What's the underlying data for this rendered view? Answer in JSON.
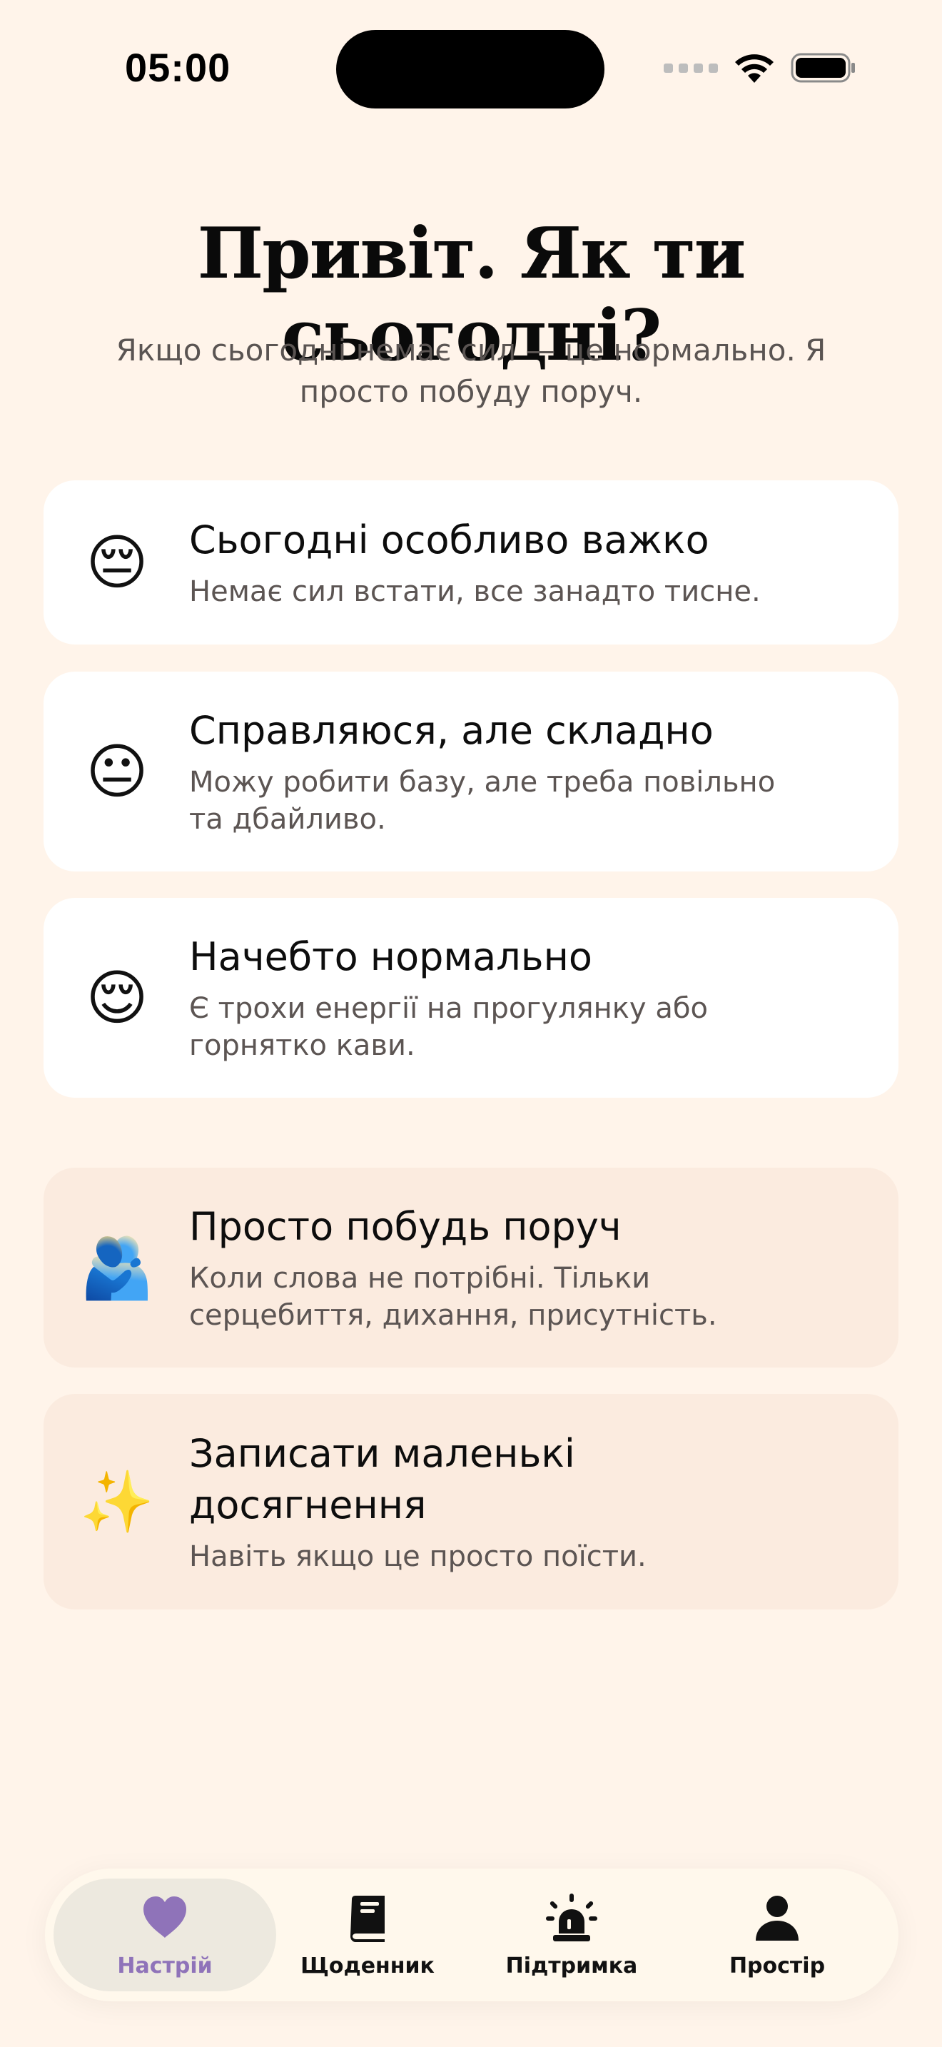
{
  "status_bar": {
    "time": "05:00"
  },
  "header": {
    "title": "Привіт. Як ти сьогодні?",
    "subtitle": "Якщо сьогодні немає сил — це нормально. Я просто побуду поруч."
  },
  "mood_options": [
    {
      "emoji": "😔",
      "title": "Сьогодні особливо важко",
      "description": "Немає сил встати, все занадто тисне."
    },
    {
      "emoji": "😐",
      "title": "Справляюся, але складно",
      "description": "Можу робити базу, але треба повільно та дбайливо."
    },
    {
      "emoji": "😌",
      "title": "Начебто нормально",
      "description": "Є трохи енергії на прогулянку або горнятко кави."
    }
  ],
  "actions": [
    {
      "emoji": "🫂",
      "title": "Просто побудь поруч",
      "description": "Коли слова не потрібні. Тільки серцебиття, дихання, присутність."
    },
    {
      "emoji": "✨",
      "title": "Записати маленькі досягнення",
      "description": "Навіть якщо це просто поїсти."
    }
  ],
  "tabs": [
    {
      "label": "Настрій",
      "icon": "heart-icon",
      "active": true
    },
    {
      "label": "Щоденник",
      "icon": "book-icon",
      "active": false
    },
    {
      "label": "Підтримка",
      "icon": "siren-icon",
      "active": false
    },
    {
      "label": "Простір",
      "icon": "person-icon",
      "active": false
    }
  ],
  "colors": {
    "background": "#FFF4EA",
    "card_white": "#FFFFFF",
    "card_peach": "#FBEBDF",
    "accent": "#8F73B9",
    "tabbar": "#FFF8EC",
    "active_tab_bg": "#EDE9DF"
  }
}
